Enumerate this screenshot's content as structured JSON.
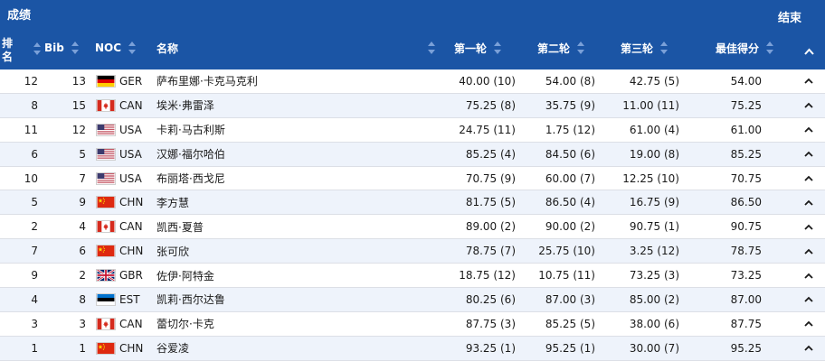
{
  "header": {
    "title": "成绩",
    "status": "结束",
    "columns": {
      "rank": "排名",
      "bib": "Bib",
      "noc": "NOC",
      "name": "名称",
      "run1": "第一轮",
      "run2": "第二轮",
      "run3": "第三轮",
      "best": "最佳得分"
    }
  },
  "rows": [
    {
      "rank": "12",
      "bib": "13",
      "noc": "GER",
      "name": "萨布里娜·卡克马克利",
      "run1": "40.00 (10)",
      "run2": "54.00 (8)",
      "run3": "42.75 (5)",
      "best": "54.00"
    },
    {
      "rank": "8",
      "bib": "15",
      "noc": "CAN",
      "name": "埃米·弗雷泽",
      "run1": "75.25 (8)",
      "run2": "35.75 (9)",
      "run3": "11.00 (11)",
      "best": "75.25"
    },
    {
      "rank": "11",
      "bib": "12",
      "noc": "USA",
      "name": "卡莉·马古利斯",
      "run1": "24.75 (11)",
      "run2": "1.75 (12)",
      "run3": "61.00 (4)",
      "best": "61.00"
    },
    {
      "rank": "6",
      "bib": "5",
      "noc": "USA",
      "name": "汉娜·福尔哈伯",
      "run1": "85.25 (4)",
      "run2": "84.50 (6)",
      "run3": "19.00 (8)",
      "best": "85.25"
    },
    {
      "rank": "10",
      "bib": "7",
      "noc": "USA",
      "name": "布丽塔·西戈尼",
      "run1": "70.75 (9)",
      "run2": "60.00 (7)",
      "run3": "12.25 (10)",
      "best": "70.75"
    },
    {
      "rank": "5",
      "bib": "9",
      "noc": "CHN",
      "name": "李方慧",
      "run1": "81.75 (5)",
      "run2": "86.50 (4)",
      "run3": "16.75 (9)",
      "best": "86.50"
    },
    {
      "rank": "2",
      "bib": "4",
      "noc": "CAN",
      "name": "凯西·夏普",
      "run1": "89.00 (2)",
      "run2": "90.00 (2)",
      "run3": "90.75 (1)",
      "best": "90.75"
    },
    {
      "rank": "7",
      "bib": "6",
      "noc": "CHN",
      "name": "张可欣",
      "run1": "78.75 (7)",
      "run2": "25.75 (10)",
      "run3": "3.25 (12)",
      "best": "78.75"
    },
    {
      "rank": "9",
      "bib": "2",
      "noc": "GBR",
      "name": "佐伊·阿特金",
      "run1": "18.75 (12)",
      "run2": "10.75 (11)",
      "run3": "73.25 (3)",
      "best": "73.25"
    },
    {
      "rank": "4",
      "bib": "8",
      "noc": "EST",
      "name": "凯莉·西尔达鲁",
      "run1": "80.25 (6)",
      "run2": "87.00 (3)",
      "run3": "85.00 (2)",
      "best": "87.00"
    },
    {
      "rank": "3",
      "bib": "3",
      "noc": "CAN",
      "name": "蕾切尔·卡克",
      "run1": "87.75 (3)",
      "run2": "85.25 (5)",
      "run3": "38.00 (6)",
      "best": "87.75"
    },
    {
      "rank": "1",
      "bib": "1",
      "noc": "CHN",
      "name": "谷爱凌",
      "run1": "93.25 (1)",
      "run2": "95.25 (1)",
      "run3": "30.00 (7)",
      "best": "95.25"
    }
  ]
}
